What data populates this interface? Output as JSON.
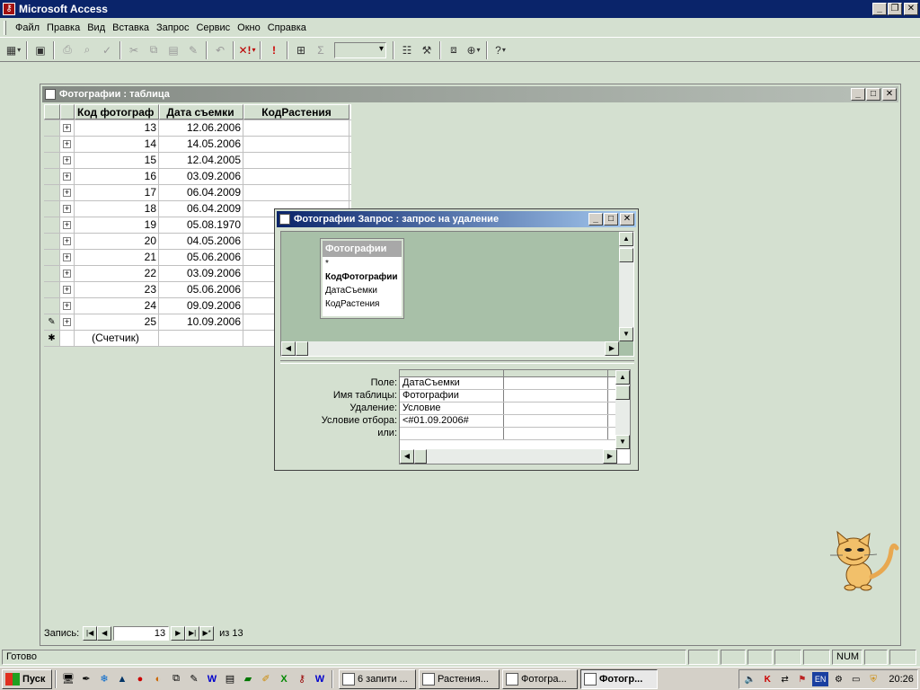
{
  "app": {
    "title": "Microsoft Access"
  },
  "menu": [
    "Файл",
    "Правка",
    "Вид",
    "Вставка",
    "Запрос",
    "Сервис",
    "Окно",
    "Справка"
  ],
  "toolbar": {
    "combo_value": "",
    "icons": [
      "view-icon",
      "save-icon",
      "print-icon",
      "preview-icon",
      "spell-icon",
      "cut-icon",
      "copy-icon",
      "paste-icon",
      "format-painter-icon",
      "undo-icon",
      "query-type-icon",
      "run-icon",
      "show-table-icon",
      "totals-icon",
      "top-values-icon",
      "properties-icon",
      "build-icon",
      "database-window-icon",
      "new-object-icon",
      "help-icon"
    ]
  },
  "table_window": {
    "title": "Фотографии : таблица",
    "columns": [
      "Код фотограф",
      "Дата съемки",
      "КодРастения"
    ],
    "rows": [
      {
        "id": "13",
        "date": "12.06.2006",
        "plant": ""
      },
      {
        "id": "14",
        "date": "14.05.2006",
        "plant": ""
      },
      {
        "id": "15",
        "date": "12.04.2005",
        "plant": ""
      },
      {
        "id": "16",
        "date": "03.09.2006",
        "plant": ""
      },
      {
        "id": "17",
        "date": "06.04.2009",
        "plant": ""
      },
      {
        "id": "18",
        "date": "06.04.2009",
        "plant": ""
      },
      {
        "id": "19",
        "date": "05.08.1970",
        "plant": ""
      },
      {
        "id": "20",
        "date": "04.05.2006",
        "plant": ""
      },
      {
        "id": "21",
        "date": "05.06.2006",
        "plant": ""
      },
      {
        "id": "22",
        "date": "03.09.2006",
        "plant": ""
      },
      {
        "id": "23",
        "date": "05.06.2006",
        "plant": ""
      },
      {
        "id": "24",
        "date": "09.09.2006",
        "plant": ""
      },
      {
        "id": "25",
        "date": "10.09.2006",
        "plant": ""
      }
    ],
    "new_row_label": "(Счетчик)",
    "record_nav": {
      "label": "Запись:",
      "current": "13",
      "of_label": "из 13"
    }
  },
  "query_window": {
    "title": "Фотографии Запрос : запрос на удаление",
    "field_list": {
      "title": "Фотографии",
      "items": [
        "*",
        "КодФотографии",
        "ДатаСъемки",
        "КодРастения"
      ]
    },
    "grid_labels": [
      "Поле:",
      "Имя таблицы:",
      "Удаление:",
      "Условие отбора:",
      "или:"
    ],
    "grid_col1": [
      "ДатаСъемки",
      "Фотографии",
      "Условие",
      "<#01.09.2006#",
      ""
    ]
  },
  "status": {
    "text": "Готово",
    "num": "NUM"
  },
  "taskbar": {
    "start_label": "Пуск",
    "tasks": [
      {
        "label": "6 запити ...",
        "active": false
      },
      {
        "label": "Растения...",
        "active": false
      },
      {
        "label": "Фотогра...",
        "active": false
      },
      {
        "label": "Фотогр...",
        "active": true
      }
    ],
    "lang": "EN",
    "clock": "20:26"
  }
}
